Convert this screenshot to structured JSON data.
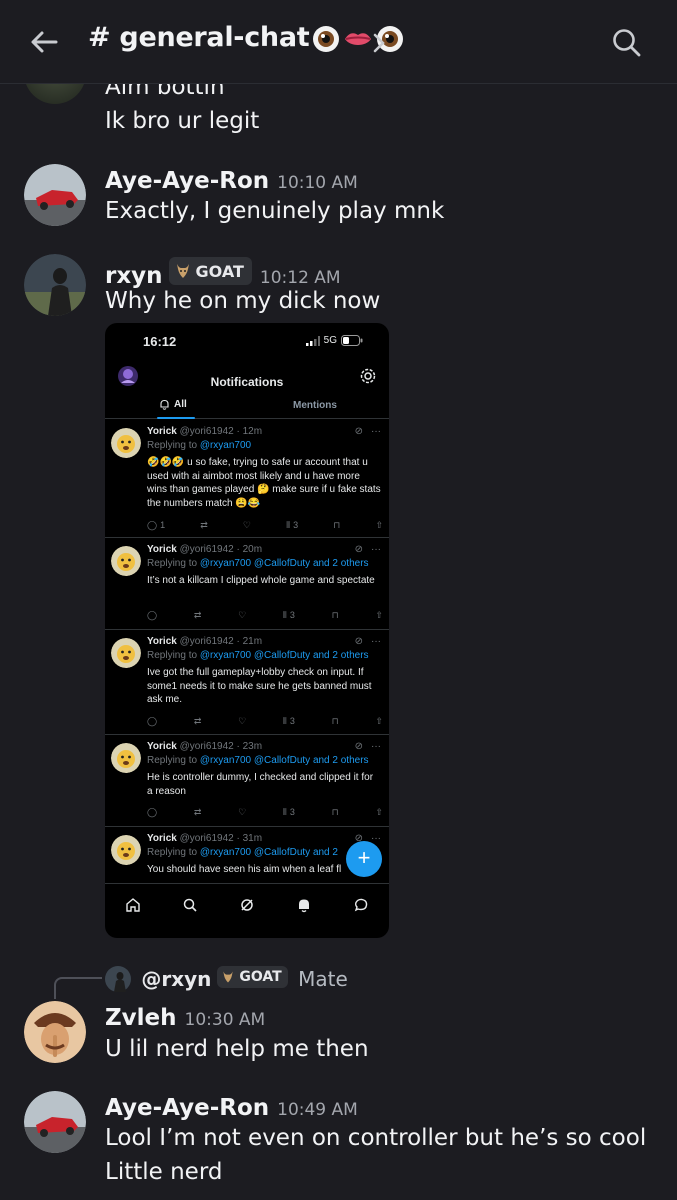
{
  "header": {
    "title": "# general-chat",
    "emojis": [
      "eye",
      "lips",
      "eye"
    ]
  },
  "messages": [
    {
      "text_lines": [
        "Aim bottin",
        "Ik bro ur legit"
      ]
    },
    {
      "author": "Aye-Aye-Ron",
      "time": "10:10 AM",
      "text": "Exactly, I genuinely play mnk"
    },
    {
      "author": "rxyn",
      "badge": "GOAT",
      "time": "10:12 AM",
      "text": "Why he on my dick now"
    },
    {
      "reply_to": {
        "author": "@rxyn",
        "badge": "GOAT",
        "text": "Mate"
      },
      "author": "Zvleh",
      "time": "10:30 AM",
      "text": "U lil nerd help me then"
    },
    {
      "author": "Aye-Aye-Ron",
      "time": "10:49 AM",
      "text_lines": [
        "Lool I’m not even on controller but he’s so cool",
        "Little nerd"
      ]
    }
  ],
  "screenshot": {
    "status_time": "16:12",
    "network": "5G",
    "title": "Notifications",
    "tabs": [
      "All",
      "Mentions"
    ],
    "tweets": [
      {
        "name": "Yorick",
        "handle": "@yori61942 · 12m",
        "replying_prefix": "Replying to ",
        "replying_to": "@rxyan700",
        "body": "🤣🤣🤣 u so fake, trying to safe ur account that u used with ai aimbot most likely and u have more wins than games played 🤔 make sure if u fake stats the numbers match 😩😂",
        "replies": "1",
        "views": "3"
      },
      {
        "name": "Yorick",
        "handle": "@yori61942 · 20m",
        "replying_prefix": "Replying to ",
        "replying_to": "@rxyan700 @CallofDuty and 2 others",
        "body": "It’s not a killcam I clipped whole game and spectate",
        "replies": "",
        "views": "3"
      },
      {
        "name": "Yorick",
        "handle": "@yori61942 · 21m",
        "replying_prefix": "Replying to ",
        "replying_to": "@rxyan700 @CallofDuty and 2 others",
        "body": "Ive got the full gameplay+lobby check on input. If some1 needs it to make sure he gets banned must ask me.",
        "replies": "",
        "views": "3"
      },
      {
        "name": "Yorick",
        "handle": "@yori61942 · 23m",
        "replying_prefix": "Replying to ",
        "replying_to": "@rxyan700 @CallofDuty and 2 others",
        "body": "He is controller dummy, I checked and clipped it for a reason",
        "replies": "",
        "views": "3"
      },
      {
        "name": "Yorick",
        "handle": "@yori61942 · 31m",
        "replying_prefix": "Replying to ",
        "replying_to": "@rxyan700 @CallofDuty and 2",
        "body": "You should have seen his aim when a leaf fl",
        "replies": "",
        "views": ""
      }
    ],
    "fab": "+"
  }
}
